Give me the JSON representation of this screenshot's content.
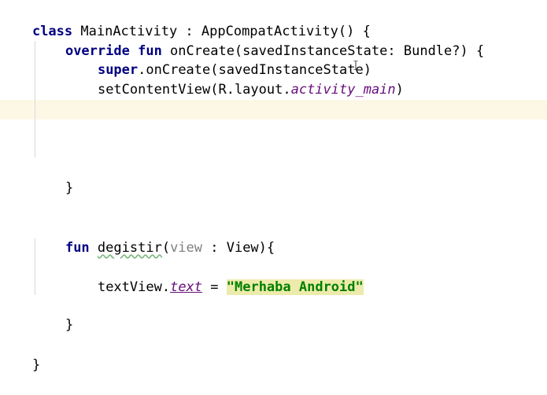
{
  "code": {
    "l1": {
      "kw": "class",
      "rest": " MainActivity : AppCompatActivity() {"
    },
    "l2": {
      "kw1": "override",
      "sp": " ",
      "kw2": "fun",
      "rest": " onCreate(savedInstanceState: Bundle?) {"
    },
    "l3": {
      "kw": "super",
      "rest": ".onCreate(savedInstanceState)"
    },
    "l4": {
      "pre": "setContentView(R.layout.",
      "ital": "activity_main",
      "post": ")"
    },
    "l5": {
      "text": "}"
    },
    "l6": {
      "kw": "fun",
      "sp": " ",
      "name": "degistir",
      "open": "(",
      "ghost": "view",
      "rest": " : View){"
    },
    "l7": {
      "pre": "textView.",
      "prop": "text",
      "mid": " = ",
      "str": "\"Merhaba Android\""
    },
    "l8": {
      "text": "}"
    },
    "l9": {
      "text": "}"
    }
  },
  "cursor_icon": "text-cursor-icon",
  "colors": {
    "keyword": "#000080",
    "string": "#008000",
    "string_highlight": "#edebac",
    "current_line": "#fdf8e6",
    "synthetic_property": "#660e7a",
    "parameter_hint": "#808080"
  }
}
